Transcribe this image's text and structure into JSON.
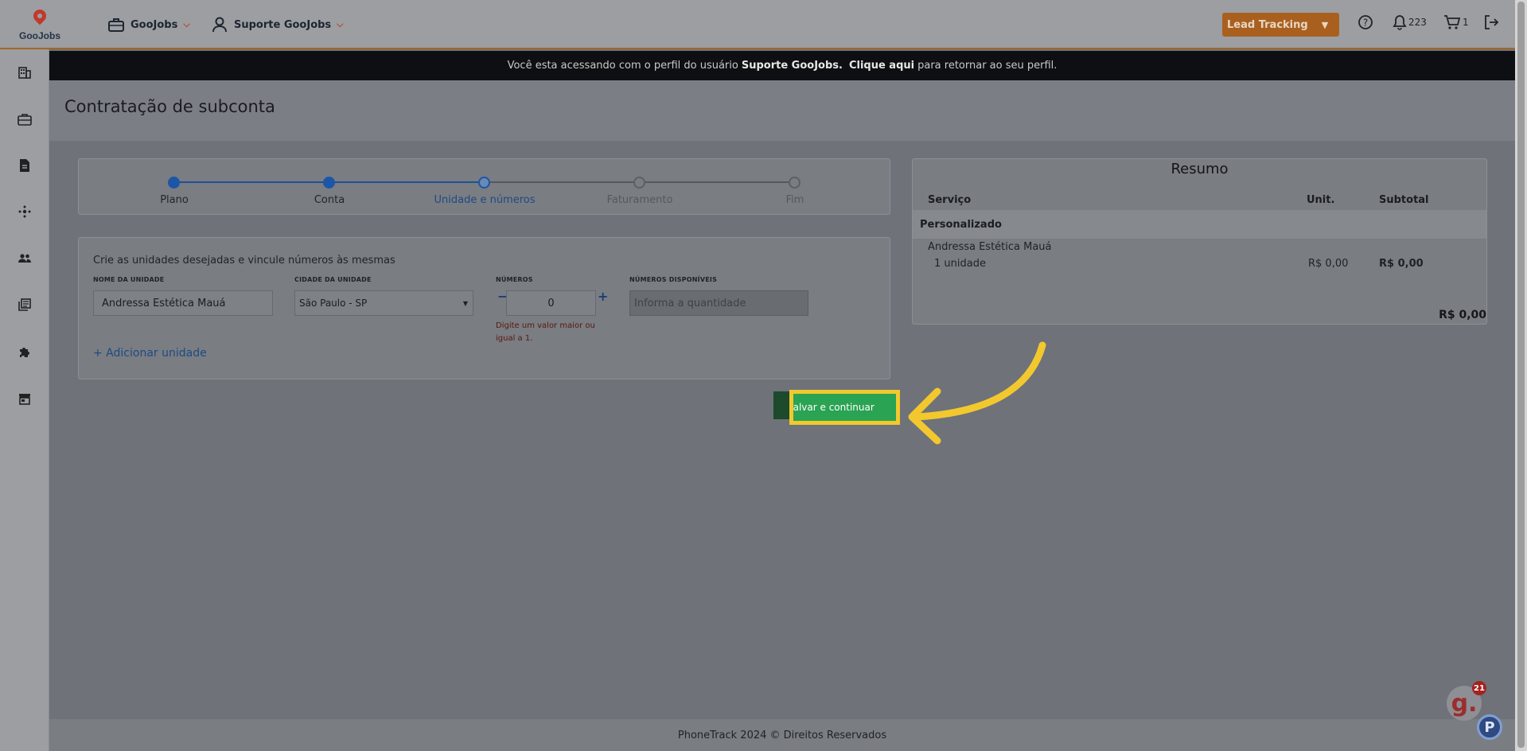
{
  "topbar": {
    "logo_text": "GooJobs",
    "nav": [
      {
        "label": "GooJobs",
        "icon": "briefcase-icon"
      },
      {
        "label": "Suporte GooJobs",
        "icon": "user-icon"
      }
    ],
    "lead_tracking": "Lead Tracking",
    "notifications_count": "223",
    "cart_count": "1"
  },
  "banner": {
    "prefix": "Você esta acessando com o perfil do usuário",
    "user": "Suporte GooJobs.",
    "link": "Clique aqui",
    "suffix": "para retornar ao seu perfil."
  },
  "page": {
    "title": "Contratação de subconta"
  },
  "stepper": {
    "steps": [
      "Plano",
      "Conta",
      "Unidade e números",
      "Faturamento",
      "Fim"
    ],
    "current_index": 2
  },
  "units": {
    "intro": "Crie as unidades desejadas e vincule números às mesmas",
    "name_label": "NOME DA UNIDADE",
    "name_value": "Andressa Estética Mauá",
    "city_label": "CIDADE DA UNIDADE",
    "city_value": "São Paulo - SP",
    "numbers_label": "NÚMEROS",
    "numbers_value": "0",
    "minus": "−",
    "plus": "+",
    "available_label": "NÚMEROS DISPONÍVEIS",
    "available_placeholder": "Informa a quantidade",
    "error": "Digite um valor maior ou igual a 1.",
    "add_unit": "+ Adicionar unidade"
  },
  "summary": {
    "title": "Resumo",
    "headers": {
      "service": "Serviço",
      "unit": "Unit.",
      "subtotal": "Subtotal"
    },
    "group": "Personalizado",
    "item_name": "Andressa Estética Mauá",
    "item_qty": "1 unidade",
    "item_unit": "R$ 0,00",
    "item_subtotal": "R$ 0,00",
    "total": "R$ 0,00"
  },
  "actions": {
    "save": "Salvar e continuar"
  },
  "footer": {
    "text": "PhoneTrack 2024 © Direitos Reservados"
  },
  "widgets": {
    "chat_badge": "21",
    "chat_letter": "g."
  },
  "colors": {
    "accent": "#2aa352",
    "highlight": "#f2c82e",
    "primary": "#1f5aa8",
    "lead_button": "#a9601f"
  }
}
